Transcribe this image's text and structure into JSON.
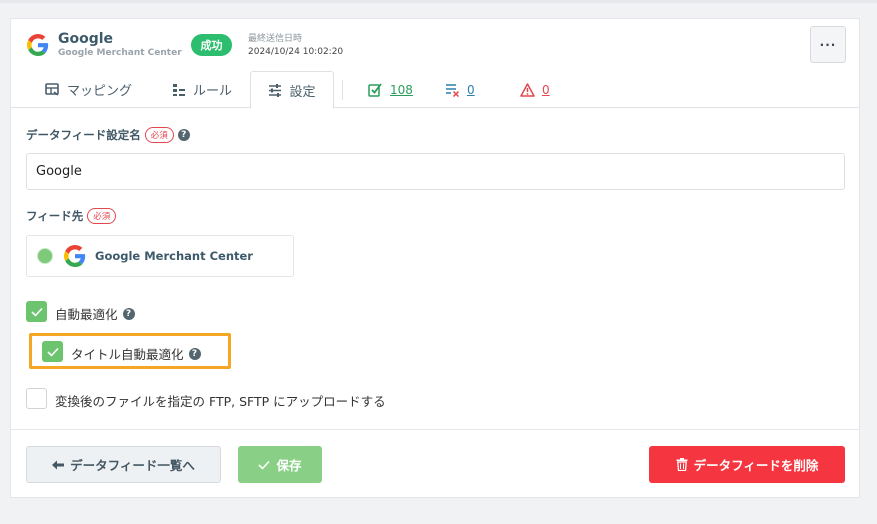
{
  "header": {
    "brand_name": "Google",
    "brand_sub": "Google Merchant Center",
    "status_badge": "成功",
    "last_sent_label": "最終送信日時",
    "last_sent_time": "2024/10/24 10:02:20",
    "more_label": "···"
  },
  "tabs": [
    {
      "label": "マッピング",
      "icon": "mapping-icon"
    },
    {
      "label": "ルール",
      "icon": "rules-icon"
    },
    {
      "label": "設定",
      "icon": "sliders-icon",
      "active": true
    },
    {
      "label": "108",
      "icon": "check-list-icon",
      "color": "#2a9d5c"
    },
    {
      "label": "0",
      "icon": "list-x-icon",
      "color": "#2a7fb0"
    },
    {
      "label": "0",
      "icon": "warning-icon",
      "color": "#e2474e"
    }
  ],
  "form": {
    "feed_name_label": "データフィード設定名",
    "required_label": "必須",
    "help_glyph": "?",
    "feed_name_value": "Google",
    "destination_label": "フィード先",
    "destination_name": "Google Merchant Center",
    "auto_optimize_label": "自動最適化",
    "title_optimize_label": "タイトル自動最適化",
    "ftp_label": "変換後のファイルを指定の FTP, SFTP にアップロードする"
  },
  "footer": {
    "back_label": "データフィード一覧へ",
    "save_label": "保存",
    "delete_label": "データフィードを削除"
  },
  "colors": {
    "success": "#2dbd6e",
    "checkbox_green": "#6cc56e",
    "highlight": "#f5a623",
    "danger": "#f5353f"
  }
}
